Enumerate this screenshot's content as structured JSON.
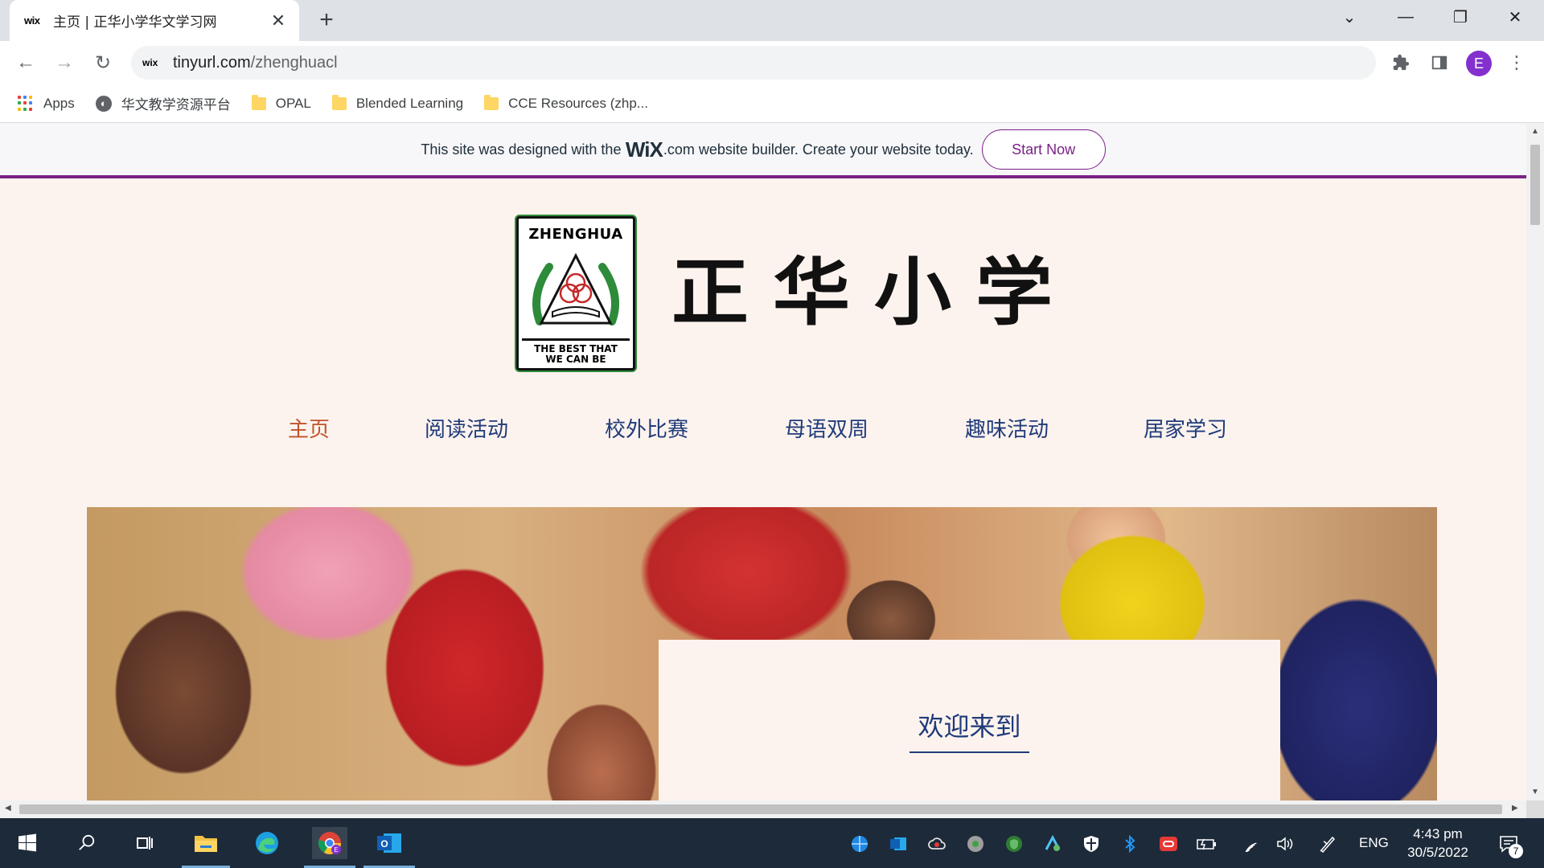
{
  "browser": {
    "tab": {
      "favicon_text": "wix",
      "title": "主页 | 正华小学华文学习网",
      "close_glyph": "✕"
    },
    "new_tab_glyph": "+",
    "window_controls": {
      "tab_search": "⌄",
      "minimize": "—",
      "restore": "❐",
      "close": "✕"
    },
    "nav": {
      "back": "←",
      "forward": "→",
      "reload": "↻"
    },
    "address": {
      "site_icon_text": "wix",
      "host": "tinyurl.com",
      "path": "/zhenghuacl"
    },
    "toolbar_icons": {
      "extensions": "extensions-icon",
      "side_panel": "side-panel-icon",
      "menu": "⋮"
    },
    "profile_initial": "E",
    "bookmarks": [
      {
        "label": "Apps",
        "icon": "apps-grid-icon"
      },
      {
        "label": "华文教学资源平台",
        "icon": "globe-icon"
      },
      {
        "label": "OPAL",
        "icon": "folder-icon"
      },
      {
        "label": "Blended Learning",
        "icon": "folder-icon"
      },
      {
        "label": "CCE Resources (zhp...",
        "icon": "folder-icon"
      }
    ]
  },
  "wix_banner": {
    "message_before": "This site was designed with the",
    "wix_logo": "WiX",
    "message_after": ".com website builder. Create your website today.",
    "button_label": "Start Now",
    "accent_color": "#7a2187"
  },
  "site": {
    "crest": {
      "name": "ZHENGHUA",
      "motto_line1": "THE BEST THAT",
      "motto_line2": "WE CAN BE"
    },
    "school_name": "正华小学",
    "nav": [
      {
        "label": "主页",
        "active": true
      },
      {
        "label": "阅读活动",
        "active": false
      },
      {
        "label": "校外比赛",
        "active": false
      },
      {
        "label": "母语双周",
        "active": false
      },
      {
        "label": "趣味活动",
        "active": false
      },
      {
        "label": "居家学习",
        "active": false
      }
    ],
    "welcome_heading": "欢迎来到",
    "colors": {
      "background": "#fdf3ee",
      "nav_text": "#1f3b7a",
      "nav_active": "#c0532a"
    }
  },
  "taskbar": {
    "apps": [
      {
        "name": "start-icon",
        "glyph": "⊞"
      },
      {
        "name": "search-icon",
        "glyph": "⌕"
      },
      {
        "name": "task-view-icon",
        "glyph": "▭"
      },
      {
        "name": "file-explorer-icon",
        "glyph": "▬"
      },
      {
        "name": "edge-icon",
        "glyph": "◉"
      },
      {
        "name": "chrome-icon",
        "glyph": "◎"
      },
      {
        "name": "outlook-icon",
        "glyph": "O"
      }
    ],
    "language": "ENG",
    "time": "4:43 pm",
    "date": "30/5/2022",
    "notification_count": "7"
  }
}
